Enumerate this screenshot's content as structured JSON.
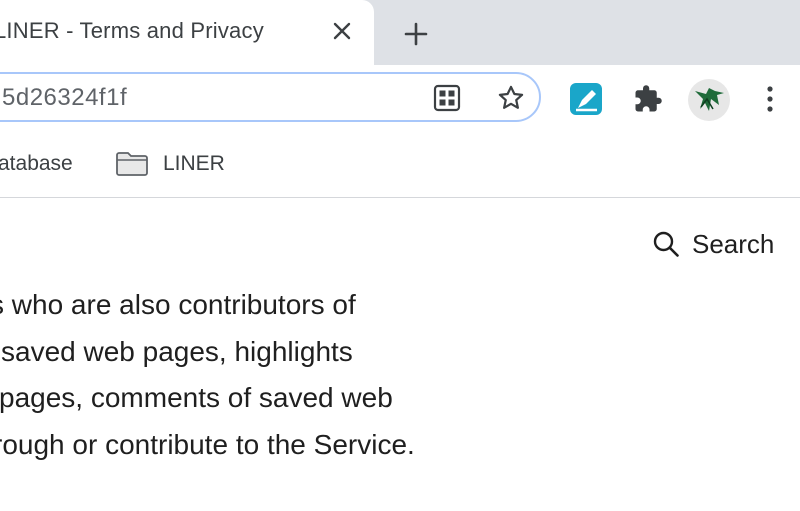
{
  "tab": {
    "title": "LINER - Terms and Privacy"
  },
  "toolbar": {
    "url": "5d26324f1f"
  },
  "bookmarks": {
    "items": [
      {
        "label": "atabase"
      },
      {
        "label": "LINER"
      }
    ]
  },
  "page": {
    "search_label": "Search",
    "paragraph_lines": [
      "s who are also contributors of",
      "saved web pages, highlights",
      "pages, comments of saved web",
      "rough or contribute to the Service."
    ]
  },
  "colors": {
    "omnibox_focus": "#a8c7fa",
    "tabstrip_bg": "#dee1e6",
    "liner_extension": "#1aa6c9"
  }
}
